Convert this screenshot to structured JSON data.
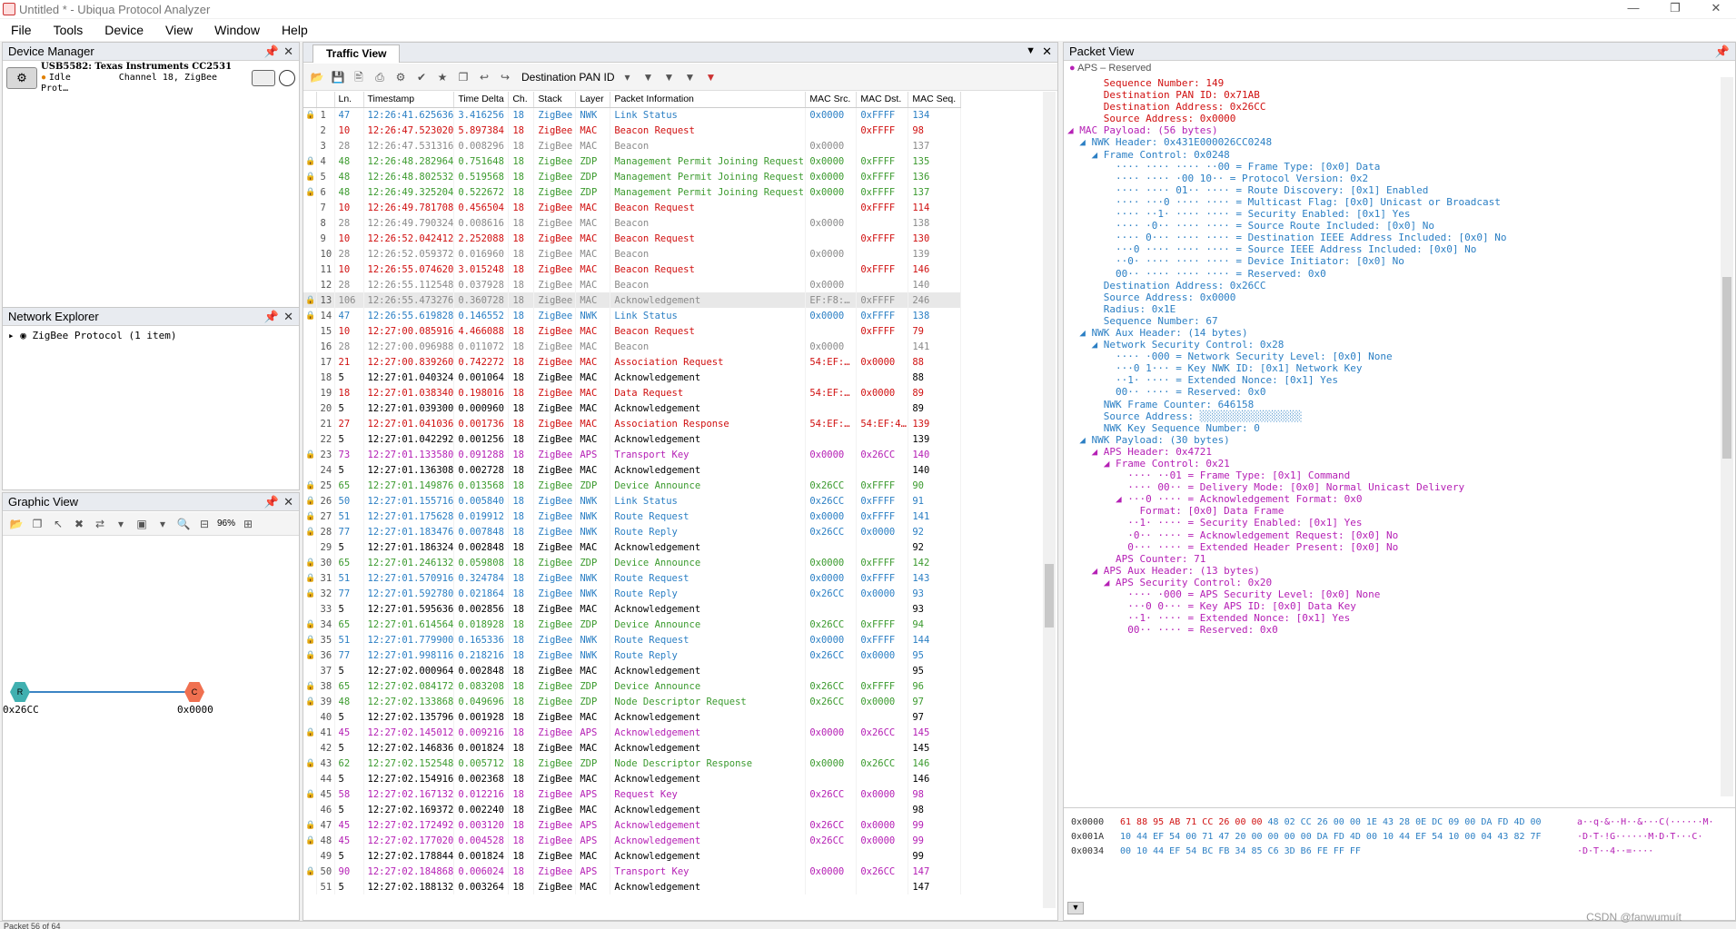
{
  "window": {
    "title": "Untitled * - Ubiqua Protocol Analyzer"
  },
  "menu": [
    "File",
    "Tools",
    "Device",
    "View",
    "Window",
    "Help"
  ],
  "device_manager": {
    "title": "Device Manager",
    "device_name": "USB5582: Texas Instruments CC2531",
    "status": "Idle",
    "channel": "Channel 18, ZigBee Prot…"
  },
  "network_explorer": {
    "title": "Network Explorer",
    "item": "ZigBee Protocol (1 item)"
  },
  "graphic_view": {
    "title": "Graphic View",
    "zoom": "96%",
    "nodes": [
      {
        "label": "0x26CC",
        "glyph": "R",
        "color": "#40b0b0"
      },
      {
        "label": "0x0000",
        "glyph": "C",
        "color": "#f07050"
      }
    ]
  },
  "traffic_view": {
    "tab": "Traffic View",
    "filter_label": "Destination PAN ID",
    "columns": [
      "Ln.",
      "Timestamp",
      "Time Delta",
      "Ch.",
      "Stack",
      "Layer",
      "Packet Information",
      "MAC Src.",
      "MAC Dst.",
      "MAC Seq."
    ],
    "rows": [
      [
        "1",
        "47",
        "12:26:41.625636",
        "3.416256",
        "18",
        "ZigBee",
        "NWK",
        "Link Status",
        "0x0000",
        "0xFFFF",
        "134",
        "blue"
      ],
      [
        "2",
        "10",
        "12:26:47.523020",
        "5.897384",
        "18",
        "ZigBee",
        "MAC",
        "Beacon Request",
        "",
        "0xFFFF",
        "98",
        "red"
      ],
      [
        "3",
        "28",
        "12:26:47.531316",
        "0.008296",
        "18",
        "ZigBee",
        "MAC",
        "Beacon",
        "0x0000",
        "",
        "137",
        "gray"
      ],
      [
        "4",
        "48",
        "12:26:48.282964",
        "0.751648",
        "18",
        "ZigBee",
        "ZDP",
        "Management Permit Joining Request",
        "0x0000",
        "0xFFFF",
        "135",
        "green"
      ],
      [
        "5",
        "48",
        "12:26:48.802532",
        "0.519568",
        "18",
        "ZigBee",
        "ZDP",
        "Management Permit Joining Request",
        "0x0000",
        "0xFFFF",
        "136",
        "green"
      ],
      [
        "6",
        "48",
        "12:26:49.325204",
        "0.522672",
        "18",
        "ZigBee",
        "ZDP",
        "Management Permit Joining Request",
        "0x0000",
        "0xFFFF",
        "137",
        "green"
      ],
      [
        "7",
        "10",
        "12:26:49.781708",
        "0.456504",
        "18",
        "ZigBee",
        "MAC",
        "Beacon Request",
        "",
        "0xFFFF",
        "114",
        "red"
      ],
      [
        "8",
        "28",
        "12:26:49.790324",
        "0.008616",
        "18",
        "ZigBee",
        "MAC",
        "Beacon",
        "0x0000",
        "",
        "138",
        "gray"
      ],
      [
        "9",
        "10",
        "12:26:52.042412",
        "2.252088",
        "18",
        "ZigBee",
        "MAC",
        "Beacon Request",
        "",
        "0xFFFF",
        "130",
        "red"
      ],
      [
        "10",
        "28",
        "12:26:52.059372",
        "0.016960",
        "18",
        "ZigBee",
        "MAC",
        "Beacon",
        "0x0000",
        "",
        "139",
        "gray"
      ],
      [
        "11",
        "10",
        "12:26:55.074620",
        "3.015248",
        "18",
        "ZigBee",
        "MAC",
        "Beacon Request",
        "",
        "0xFFFF",
        "146",
        "red"
      ],
      [
        "12",
        "28",
        "12:26:55.112548",
        "0.037928",
        "18",
        "ZigBee",
        "MAC",
        "Beacon",
        "0x0000",
        "",
        "140",
        "gray"
      ],
      [
        "13",
        "106",
        "12:26:55.473276",
        "0.360728",
        "18",
        "ZigBee",
        "MAC",
        "Acknowledgement",
        "EF:F8:…",
        "0xFFFF",
        "246",
        "sel"
      ],
      [
        "14",
        "47",
        "12:26:55.619828",
        "0.146552",
        "18",
        "ZigBee",
        "NWK",
        "Link Status",
        "0x0000",
        "0xFFFF",
        "138",
        "blue"
      ],
      [
        "15",
        "10",
        "12:27:00.085916",
        "4.466088",
        "18",
        "ZigBee",
        "MAC",
        "Beacon Request",
        "",
        "0xFFFF",
        "79",
        "red"
      ],
      [
        "16",
        "28",
        "12:27:00.096988",
        "0.011072",
        "18",
        "ZigBee",
        "MAC",
        "Beacon",
        "0x0000",
        "",
        "141",
        "gray"
      ],
      [
        "17",
        "21",
        "12:27:00.839260",
        "0.742272",
        "18",
        "ZigBee",
        "MAC",
        "Association Request",
        "54:EF:…",
        "0x0000",
        "88",
        "red"
      ],
      [
        "18",
        "5",
        "12:27:01.040324",
        "0.001064",
        "18",
        "ZigBee",
        "MAC",
        "Acknowledgement",
        "",
        "",
        "88",
        "black"
      ],
      [
        "19",
        "18",
        "12:27:01.038340",
        "0.198016",
        "18",
        "ZigBee",
        "MAC",
        "Data Request",
        "54:EF:…",
        "0x0000",
        "89",
        "red"
      ],
      [
        "20",
        "5",
        "12:27:01.039300",
        "0.000960",
        "18",
        "ZigBee",
        "MAC",
        "Acknowledgement",
        "",
        "",
        "89",
        "black"
      ],
      [
        "21",
        "27",
        "12:27:01.041036",
        "0.001736",
        "18",
        "ZigBee",
        "MAC",
        "Association Response",
        "54:EF:…",
        "54:EF:4…",
        "139",
        "red"
      ],
      [
        "22",
        "5",
        "12:27:01.042292",
        "0.001256",
        "18",
        "ZigBee",
        "MAC",
        "Acknowledgement",
        "",
        "",
        "139",
        "black"
      ],
      [
        "23",
        "73",
        "12:27:01.133580",
        "0.091288",
        "18",
        "ZigBee",
        "APS",
        "Transport Key",
        "0x0000",
        "0x26CC",
        "140",
        "purple"
      ],
      [
        "24",
        "5",
        "12:27:01.136308",
        "0.002728",
        "18",
        "ZigBee",
        "MAC",
        "Acknowledgement",
        "",
        "",
        "140",
        "black"
      ],
      [
        "25",
        "65",
        "12:27:01.149876",
        "0.013568",
        "18",
        "ZigBee",
        "ZDP",
        "Device Announce",
        "0x26CC",
        "0xFFFF",
        "90",
        "green"
      ],
      [
        "26",
        "50",
        "12:27:01.155716",
        "0.005840",
        "18",
        "ZigBee",
        "NWK",
        "Link Status",
        "0x26CC",
        "0xFFFF",
        "91",
        "blue"
      ],
      [
        "27",
        "51",
        "12:27:01.175628",
        "0.019912",
        "18",
        "ZigBee",
        "NWK",
        "Route Request",
        "0x0000",
        "0xFFFF",
        "141",
        "blue"
      ],
      [
        "28",
        "77",
        "12:27:01.183476",
        "0.007848",
        "18",
        "ZigBee",
        "NWK",
        "Route Reply",
        "0x26CC",
        "0x0000",
        "92",
        "blue"
      ],
      [
        "29",
        "5",
        "12:27:01.186324",
        "0.002848",
        "18",
        "ZigBee",
        "MAC",
        "Acknowledgement",
        "",
        "",
        "92",
        "black"
      ],
      [
        "30",
        "65",
        "12:27:01.246132",
        "0.059808",
        "18",
        "ZigBee",
        "ZDP",
        "Device Announce",
        "0x0000",
        "0xFFFF",
        "142",
        "green"
      ],
      [
        "31",
        "51",
        "12:27:01.570916",
        "0.324784",
        "18",
        "ZigBee",
        "NWK",
        "Route Request",
        "0x0000",
        "0xFFFF",
        "143",
        "blue"
      ],
      [
        "32",
        "77",
        "12:27:01.592780",
        "0.021864",
        "18",
        "ZigBee",
        "NWK",
        "Route Reply",
        "0x26CC",
        "0x0000",
        "93",
        "blue"
      ],
      [
        "33",
        "5",
        "12:27:01.595636",
        "0.002856",
        "18",
        "ZigBee",
        "MAC",
        "Acknowledgement",
        "",
        "",
        "93",
        "black"
      ],
      [
        "34",
        "65",
        "12:27:01.614564",
        "0.018928",
        "18",
        "ZigBee",
        "ZDP",
        "Device Announce",
        "0x26CC",
        "0xFFFF",
        "94",
        "green"
      ],
      [
        "35",
        "51",
        "12:27:01.779900",
        "0.165336",
        "18",
        "ZigBee",
        "NWK",
        "Route Request",
        "0x0000",
        "0xFFFF",
        "144",
        "blue"
      ],
      [
        "36",
        "77",
        "12:27:01.998116",
        "0.218216",
        "18",
        "ZigBee",
        "NWK",
        "Route Reply",
        "0x26CC",
        "0x0000",
        "95",
        "blue"
      ],
      [
        "37",
        "5",
        "12:27:02.000964",
        "0.002848",
        "18",
        "ZigBee",
        "MAC",
        "Acknowledgement",
        "",
        "",
        "95",
        "black"
      ],
      [
        "38",
        "65",
        "12:27:02.084172",
        "0.083208",
        "18",
        "ZigBee",
        "ZDP",
        "Device Announce",
        "0x26CC",
        "0xFFFF",
        "96",
        "green"
      ],
      [
        "39",
        "48",
        "12:27:02.133868",
        "0.049696",
        "18",
        "ZigBee",
        "ZDP",
        "Node Descriptor Request",
        "0x26CC",
        "0x0000",
        "97",
        "green"
      ],
      [
        "40",
        "5",
        "12:27:02.135796",
        "0.001928",
        "18",
        "ZigBee",
        "MAC",
        "Acknowledgement",
        "",
        "",
        "97",
        "black"
      ],
      [
        "41",
        "45",
        "12:27:02.145012",
        "0.009216",
        "18",
        "ZigBee",
        "APS",
        "Acknowledgement",
        "0x0000",
        "0x26CC",
        "145",
        "purple"
      ],
      [
        "42",
        "5",
        "12:27:02.146836",
        "0.001824",
        "18",
        "ZigBee",
        "MAC",
        "Acknowledgement",
        "",
        "",
        "145",
        "black"
      ],
      [
        "43",
        "62",
        "12:27:02.152548",
        "0.005712",
        "18",
        "ZigBee",
        "ZDP",
        "Node Descriptor Response",
        "0x0000",
        "0x26CC",
        "146",
        "green"
      ],
      [
        "44",
        "5",
        "12:27:02.154916",
        "0.002368",
        "18",
        "ZigBee",
        "MAC",
        "Acknowledgement",
        "",
        "",
        "146",
        "black"
      ],
      [
        "45",
        "58",
        "12:27:02.167132",
        "0.012216",
        "18",
        "ZigBee",
        "APS",
        "Request Key",
        "0x26CC",
        "0x0000",
        "98",
        "purple"
      ],
      [
        "46",
        "5",
        "12:27:02.169372",
        "0.002240",
        "18",
        "ZigBee",
        "MAC",
        "Acknowledgement",
        "",
        "",
        "98",
        "black"
      ],
      [
        "47",
        "45",
        "12:27:02.172492",
        "0.003120",
        "18",
        "ZigBee",
        "APS",
        "Acknowledgement",
        "0x26CC",
        "0x0000",
        "99",
        "purple"
      ],
      [
        "48",
        "45",
        "12:27:02.177020",
        "0.004528",
        "18",
        "ZigBee",
        "APS",
        "Acknowledgement",
        "0x26CC",
        "0x0000",
        "99",
        "purple"
      ],
      [
        "49",
        "5",
        "12:27:02.178844",
        "0.001824",
        "18",
        "ZigBee",
        "MAC",
        "Acknowledgement",
        "",
        "",
        "99",
        "black"
      ],
      [
        "50",
        "90",
        "12:27:02.184868",
        "0.006024",
        "18",
        "ZigBee",
        "APS",
        "Transport Key",
        "0x0000",
        "0x26CC",
        "147",
        "purple"
      ],
      [
        "51",
        "5",
        "12:27:02.188132",
        "0.003264",
        "18",
        "ZigBee",
        "MAC",
        "Acknowledgement",
        "",
        "",
        "147",
        "black"
      ]
    ]
  },
  "packet_view": {
    "title": "Packet View",
    "subtitle": "APS – Reserved",
    "tree": [
      [
        "      Sequence Number: 149",
        "red"
      ],
      [
        "      Destination PAN ID: 0x71AB",
        "red"
      ],
      [
        "      Destination Address: 0x26CC",
        "red"
      ],
      [
        "      Source Address: 0x0000",
        "red"
      ],
      [
        "◢ MAC Payload: (56 bytes)",
        "purple"
      ],
      [
        "  ◢ NWK Header: 0x431E000026CC0248",
        "blue"
      ],
      [
        "    ◢ Frame Control: 0x0248",
        "blue"
      ],
      [
        "        ···· ···· ···· ··00 = Frame Type: [0x0] Data",
        "blue"
      ],
      [
        "        ···· ···· ·00 10·· = Protocol Version: 0x2",
        "blue"
      ],
      [
        "        ···· ···· 01·· ···· = Route Discovery: [0x1] Enabled",
        "blue"
      ],
      [
        "        ···· ···0 ···· ···· = Multicast Flag: [0x0] Unicast or Broadcast",
        "blue"
      ],
      [
        "        ···· ··1· ···· ···· = Security Enabled: [0x1] Yes",
        "blue"
      ],
      [
        "        ···· ·0·· ···· ···· = Source Route Included: [0x0] No",
        "blue"
      ],
      [
        "        ···· 0··· ···· ···· = Destination IEEE Address Included: [0x0] No",
        "blue"
      ],
      [
        "        ···0 ···· ···· ···· = Source IEEE Address Included: [0x0] No",
        "blue"
      ],
      [
        "        ··0· ···· ···· ···· = Device Initiator: [0x0] No",
        "blue"
      ],
      [
        "        00·· ···· ···· ···· = Reserved: 0x0",
        "blue"
      ],
      [
        "      Destination Address: 0x26CC",
        "blue"
      ],
      [
        "      Source Address: 0x0000",
        "blue"
      ],
      [
        "      Radius: 0x1E",
        "blue"
      ],
      [
        "      Sequence Number: 67",
        "blue"
      ],
      [
        "  ◢ NWK Aux Header: (14 bytes)",
        "blue"
      ],
      [
        "    ◢ Network Security Control: 0x28",
        "blue"
      ],
      [
        "        ···· ·000 = Network Security Level: [0x0] None",
        "blue"
      ],
      [
        "        ···0 1··· = Key NWK ID: [0x1] Network Key",
        "blue"
      ],
      [
        "        ··1· ···· = Extended Nonce: [0x1] Yes",
        "blue"
      ],
      [
        "        00·· ···· = Reserved: 0x0",
        "blue"
      ],
      [
        "      NWK Frame Counter: 646158",
        "blue"
      ],
      [
        "      Source Address: ░░░░░░░░░░░░░░░░░",
        "blue"
      ],
      [
        "      NWK Key Sequence Number: 0",
        "blue"
      ],
      [
        "  ◢ NWK Payload: (30 bytes)",
        "blue"
      ],
      [
        "    ◢ APS Header: 0x4721",
        "purple"
      ],
      [
        "      ◢ Frame Control: 0x21",
        "purple"
      ],
      [
        "          ···· ··01 = Frame Type: [0x1] Command",
        "purple"
      ],
      [
        "          ···· 00·· = Delivery Mode: [0x0] Normal Unicast Delivery",
        "purple"
      ],
      [
        "        ◢ ···0 ···· = Acknowledgement Format: 0x0",
        "purple"
      ],
      [
        "            Format: [0x0] Data Frame",
        "purple"
      ],
      [
        "          ··1· ···· = Security Enabled: [0x1] Yes",
        "purple"
      ],
      [
        "          ·0·· ···· = Acknowledgement Request: [0x0] No",
        "purple"
      ],
      [
        "          0··· ···· = Extended Header Present: [0x0] No",
        "purple"
      ],
      [
        "        APS Counter: 71",
        "purple"
      ],
      [
        "    ◢ APS Aux Header: (13 bytes)",
        "purple"
      ],
      [
        "      ◢ APS Security Control: 0x20",
        "purple"
      ],
      [
        "          ···· ·000 = APS Security Level: [0x0] None",
        "purple"
      ],
      [
        "          ···0 0··· = Key APS ID: [0x0] Data Key",
        "purple"
      ],
      [
        "          ··1· ···· = Extended Nonce: [0x1] Yes",
        "purple"
      ],
      [
        "          00·· ···· = Reserved: 0x0",
        "purple"
      ]
    ],
    "hex": [
      {
        "offset": "0x0000",
        "bytes_red": "61 88 95 AB 71 CC 26 00 00",
        "bytes_blue": " 48 02 CC 26 00 00 1E 43 28 0E DC 09 00 DA FD 4D 00",
        "ascii": "a··q·&··H··&···C(······M·"
      },
      {
        "offset": "0x001A",
        "bytes_red": "",
        "bytes_blue": "10 44 EF 54 00 71 47 20 00 00 00 00 DA FD 4D 00 10 44 EF 54 10 00 04 43 82 7F",
        "ascii": "·D·T·!G······M·D·T···C·"
      },
      {
        "offset": "0x0034",
        "bytes_red": "",
        "bytes_blue": "00 10 44 EF 54 BC FB 34 85 C6 3D B6 FE FF FF",
        "ascii": "·D·T··4··=····"
      }
    ]
  },
  "status_bar": {
    "text": "Packet 56 of 64",
    "watermark": "CSDN @fanwumuít"
  }
}
